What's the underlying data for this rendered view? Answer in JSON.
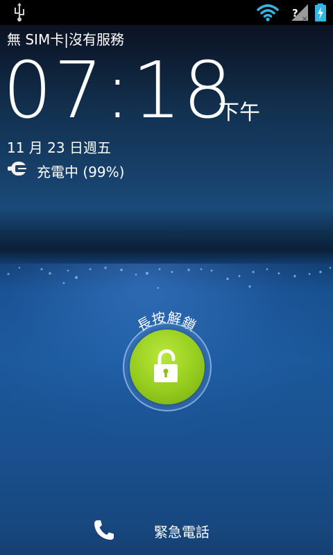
{
  "status_bar": {
    "icons": [
      "usb-icon",
      "wifi-icon",
      "no-sim-icon",
      "battery-charging-icon"
    ]
  },
  "lockscreen": {
    "carrier": "無 SIM卡|沒有服務",
    "time": "07:18",
    "ampm": "下午",
    "date": "11 月 23 日週五",
    "charging_status": "充電中 (99%)",
    "unlock_hint": "長按解鎖",
    "unlock_icon": "unlocked-padlock-icon",
    "emergency_call": "緊急電話",
    "emergency_icon": "phone-icon"
  },
  "colors": {
    "accent_green": "#95cc1e",
    "wifi_blue": "#33b5e5",
    "background_blue": "#1a5899"
  }
}
